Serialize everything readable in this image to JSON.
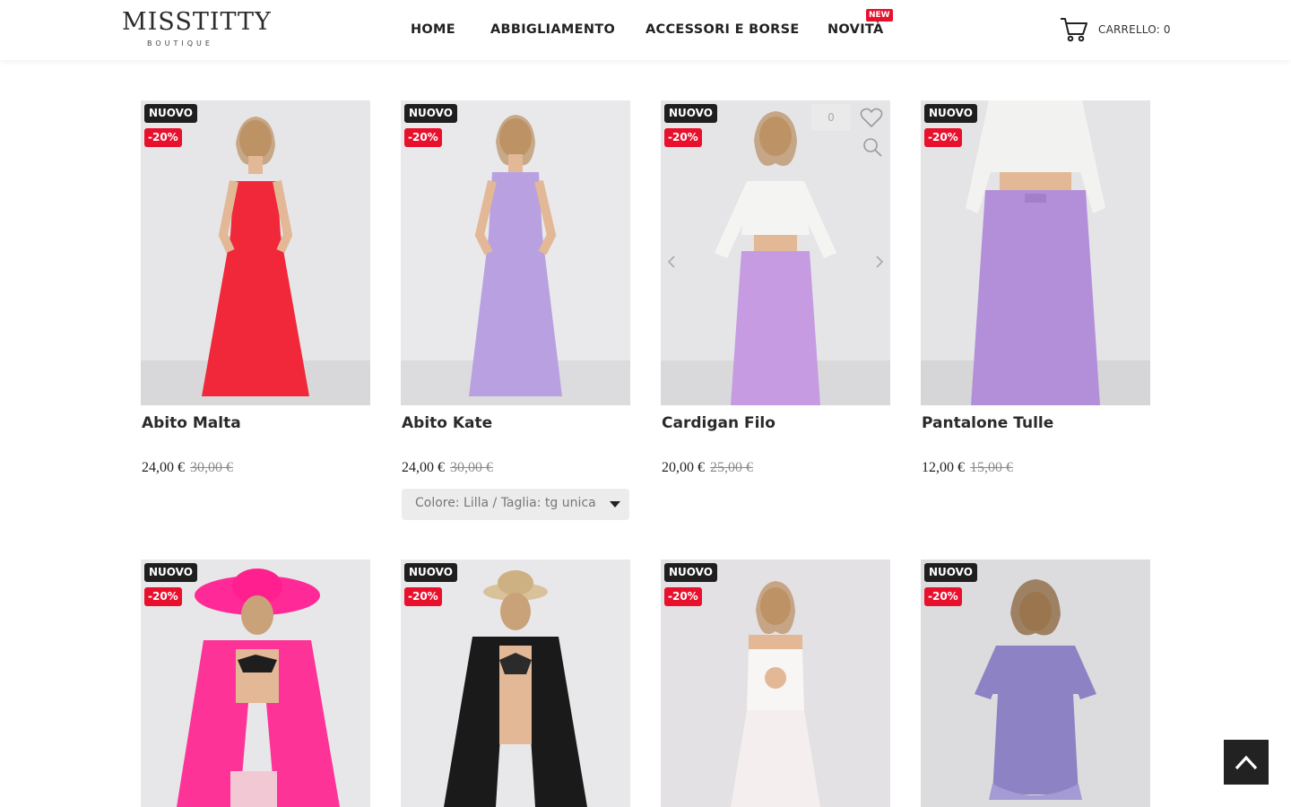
{
  "brand": {
    "name": "MISSTITTY",
    "tagline": "BOUTIQUE"
  },
  "nav": {
    "items": [
      "HOME",
      "ABBIGLIAMENTO",
      "ACCESSORI E BORSE",
      "NOVITÀ"
    ],
    "new_badge": "NEW"
  },
  "cart": {
    "label": "CARRELLO: 0",
    "icon": "cart-icon"
  },
  "badges": {
    "new": "NUOVO",
    "sale": "-20%"
  },
  "products": [
    {
      "name": "Abito Malta",
      "price": "24,00 €",
      "old_price": "30,00 €",
      "garment_color": "#f0283a"
    },
    {
      "name": "Abito Kate",
      "price": "24,00 €",
      "old_price": "30,00 €",
      "variant": "Colore: Lilla / Taglia: tg unica",
      "garment_color": "#b9a0e0"
    },
    {
      "name": "Cardigan Filo",
      "price": "20,00 €",
      "old_price": "25,00 €",
      "wishlist_count": "0",
      "garment_color": "#c69be2"
    },
    {
      "name": "Pantalone Tulle",
      "price": "12,00 €",
      "old_price": "15,00 €",
      "garment_color": "#b48fd9"
    },
    {
      "garment_color": "#ff1f8e"
    },
    {
      "garment_color": "#1a1a1a"
    },
    {
      "garment_color": "#f4eeee"
    },
    {
      "garment_color": "#8d82c4"
    }
  ],
  "colors": {
    "sale_red": "#e8112d",
    "badge_dark": "#1f1f1f",
    "to_top_bg": "#222222"
  },
  "icons": {
    "wishlist": "heart-icon",
    "quick_view": "magnifier-icon",
    "scroll_top": "chevron-up-icon"
  }
}
